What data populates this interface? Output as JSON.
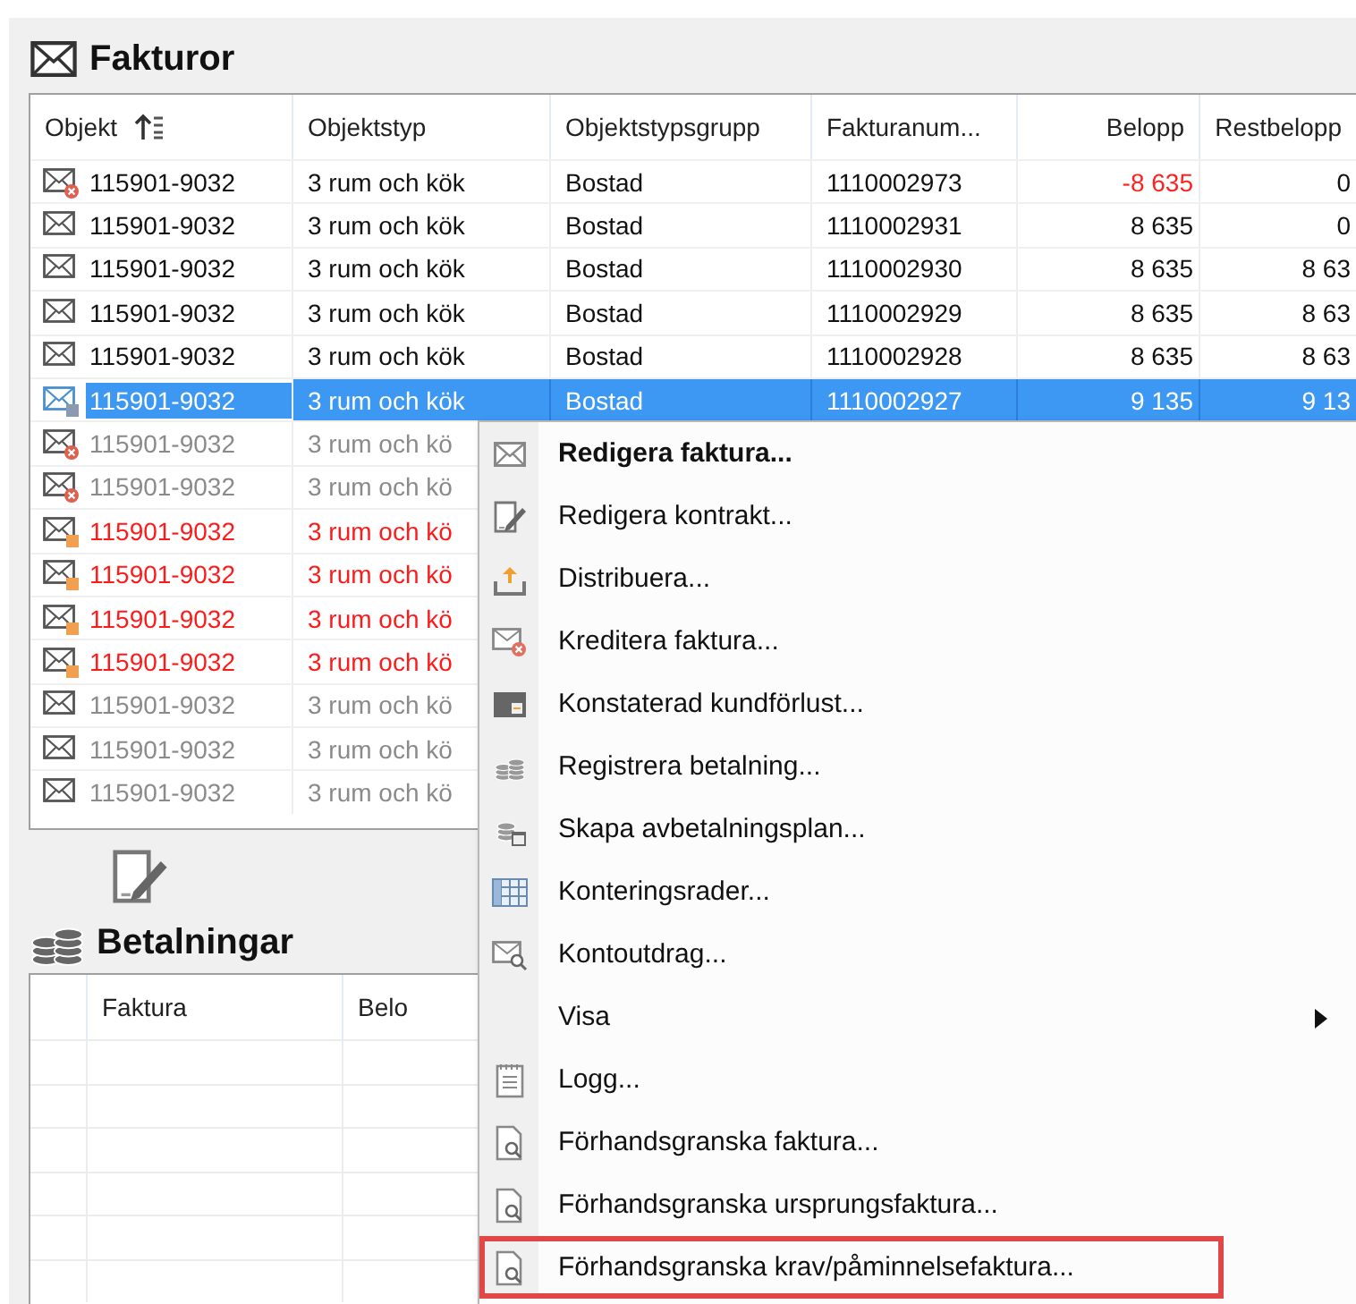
{
  "invoices": {
    "title": "Fakturor",
    "columns": [
      {
        "label": "Objekt",
        "sorted": true
      },
      {
        "label": "Objektstyp",
        "sorted": false
      },
      {
        "label": "Objektstypsgrupp",
        "sorted": false
      },
      {
        "label": "Fakturanum...",
        "sorted": false
      },
      {
        "label": "Belopp",
        "sorted": false
      },
      {
        "label": "Restbelopp",
        "sorted": false
      }
    ],
    "rows": [
      {
        "kind": "credit",
        "dimmed": false,
        "overdue": false,
        "selected": false,
        "cells": [
          "115901-9032",
          "3 rum och kök",
          "Bostad",
          "1110002973",
          "-8 635",
          "0"
        ],
        "negative": true
      },
      {
        "kind": "invoice",
        "dimmed": false,
        "overdue": false,
        "selected": false,
        "cells": [
          "115901-9032",
          "3 rum och kök",
          "Bostad",
          "1110002931",
          "8 635",
          "0"
        ],
        "negative": false
      },
      {
        "kind": "invoice",
        "dimmed": false,
        "overdue": false,
        "selected": false,
        "cells": [
          "115901-9032",
          "3 rum och kök",
          "Bostad",
          "1110002930",
          "8 635",
          "8 63"
        ],
        "negative": false
      },
      {
        "kind": "invoice",
        "dimmed": false,
        "overdue": false,
        "selected": false,
        "cells": [
          "115901-9032",
          "3 rum och kök",
          "Bostad",
          "1110002929",
          "8 635",
          "8 63"
        ],
        "negative": false
      },
      {
        "kind": "invoice",
        "dimmed": false,
        "overdue": false,
        "selected": false,
        "cells": [
          "115901-9032",
          "3 rum och kök",
          "Bostad",
          "1110002928",
          "8 635",
          "8 63"
        ],
        "negative": false
      },
      {
        "kind": "invoice",
        "dimmed": false,
        "overdue": false,
        "selected": true,
        "cells": [
          "115901-9032",
          "3 rum och kök",
          "Bostad",
          "1110002927",
          "9 135",
          "9 13"
        ],
        "negative": false
      },
      {
        "kind": "credit",
        "dimmed": true,
        "overdue": false,
        "selected": false,
        "cells": [
          "115901-9032",
          "3 rum och kö"
        ]
      },
      {
        "kind": "credit",
        "dimmed": true,
        "overdue": false,
        "selected": false,
        "cells": [
          "115901-9032",
          "3 rum och kö"
        ]
      },
      {
        "kind": "reminder",
        "overdue": true,
        "selected": false,
        "cells": [
          "115901-9032",
          "3 rum och kö"
        ]
      },
      {
        "kind": "reminder",
        "overdue": true,
        "selected": false,
        "cells": [
          "115901-9032",
          "3 rum och kö"
        ]
      },
      {
        "kind": "reminder",
        "overdue": true,
        "selected": false,
        "cells": [
          "115901-9032",
          "3 rum och kö"
        ]
      },
      {
        "kind": "reminder",
        "overdue": true,
        "selected": false,
        "cells": [
          "115901-9032",
          "3 rum och kö"
        ]
      },
      {
        "kind": "invoice",
        "dimmed": true,
        "overdue": false,
        "selected": false,
        "cells": [
          "115901-9032",
          "3 rum och kö"
        ]
      },
      {
        "kind": "invoice",
        "dimmed": true,
        "overdue": false,
        "selected": false,
        "cells": [
          "115901-9032",
          "3 rum och kö"
        ]
      },
      {
        "kind": "invoice",
        "dimmed": true,
        "overdue": false,
        "selected": false,
        "cells": [
          "115901-9032",
          "3 rum och kö"
        ]
      }
    ]
  },
  "payments": {
    "title": "Betalningar",
    "columns": [
      "Faktura",
      "Belo"
    ]
  },
  "context_menu": {
    "items": [
      {
        "label": "Redigera faktura...",
        "default": true,
        "submenu": false,
        "highlighted": false
      },
      {
        "label": "Redigera kontrakt...",
        "default": false,
        "submenu": false,
        "highlighted": false
      },
      {
        "label": "Distribuera...",
        "default": false,
        "submenu": false,
        "highlighted": false
      },
      {
        "label": "Kreditera faktura...",
        "default": false,
        "submenu": false,
        "highlighted": false
      },
      {
        "label": "Konstaterad kundförlust...",
        "default": false,
        "submenu": false,
        "highlighted": false
      },
      {
        "label": "Registrera betalning...",
        "default": false,
        "submenu": false,
        "highlighted": false
      },
      {
        "label": "Skapa avbetalningsplan...",
        "default": false,
        "submenu": false,
        "highlighted": false
      },
      {
        "label": "Konteringsrader...",
        "default": false,
        "submenu": false,
        "highlighted": false
      },
      {
        "label": "Kontoutdrag...",
        "default": false,
        "submenu": false,
        "highlighted": false
      },
      {
        "label": "Visa",
        "default": false,
        "submenu": true,
        "highlighted": false
      },
      {
        "label": "Logg...",
        "default": false,
        "submenu": false,
        "highlighted": false
      },
      {
        "label": "Förhandsgranska faktura...",
        "default": false,
        "submenu": false,
        "highlighted": false
      },
      {
        "label": "Förhandsgranska ursprungsfaktura...",
        "default": false,
        "submenu": false,
        "highlighted": false
      },
      {
        "label": "Förhandsgranska krav/påminnelsefaktura...",
        "default": false,
        "submenu": false,
        "highlighted": true
      }
    ]
  }
}
